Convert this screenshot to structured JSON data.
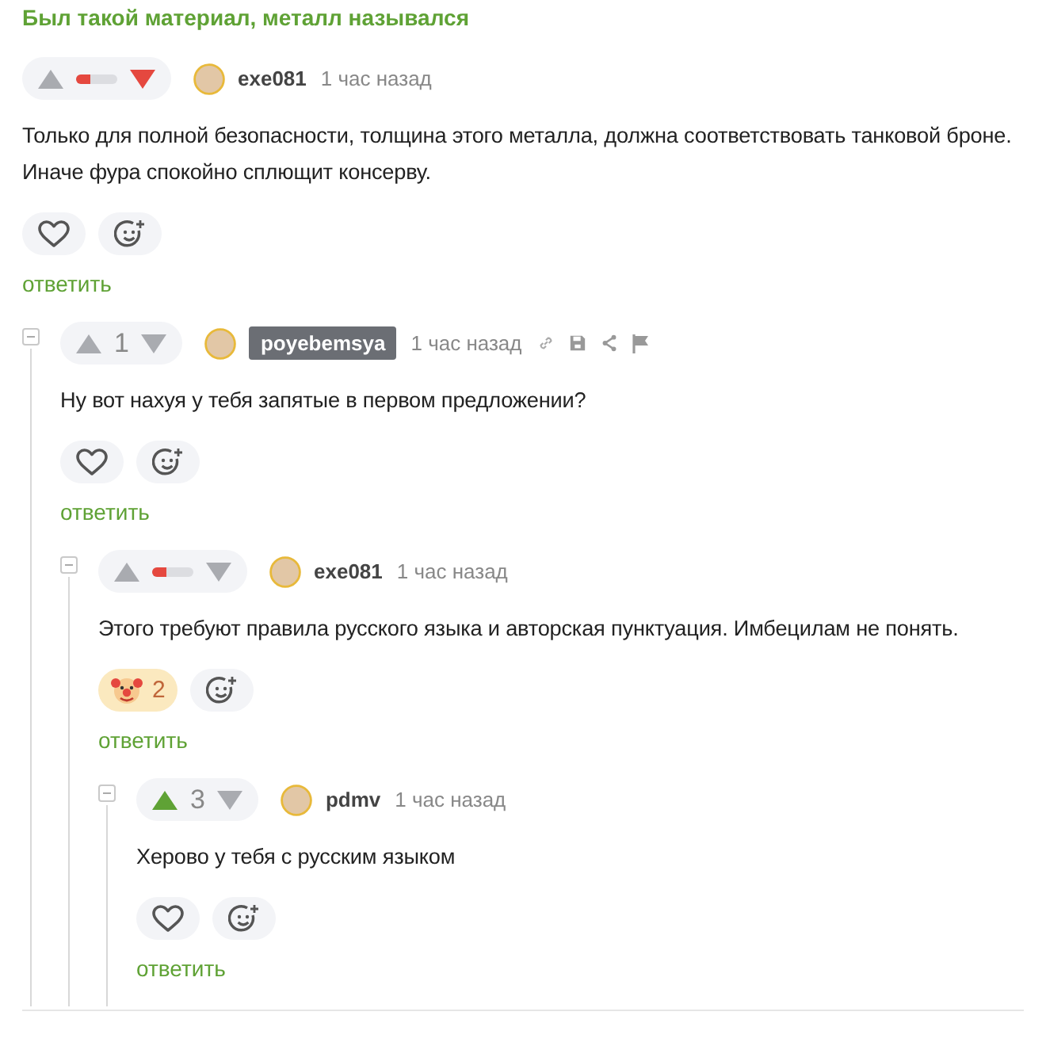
{
  "post_title": "Был такой материал, металл назывался",
  "comments": [
    {
      "rating": {
        "kind": "bar",
        "level": 0.35,
        "upvoted": false,
        "downvoted": true
      },
      "author": "exe081",
      "op": false,
      "time": "1 час назад",
      "actions_visible": false,
      "text": "Только для полной безопасности, толщина этого металла, должна соответствовать танковой броне. Иначе фура спокойно сплющит консерву.",
      "reaction": {
        "kind": "heart"
      },
      "reply": "ответить",
      "children": [
        {
          "rating": {
            "kind": "count",
            "count": "1",
            "upvoted": false,
            "downvoted": false
          },
          "author": "poyebemsya",
          "op": true,
          "time": "1 час назад",
          "actions_visible": true,
          "text": "Ну вот нахуя у тебя запятые в первом предложении?",
          "reaction": {
            "kind": "heart"
          },
          "reply": "ответить",
          "children": [
            {
              "rating": {
                "kind": "bar",
                "level": 0.35,
                "upvoted": false,
                "downvoted": false
              },
              "author": "exe081",
              "op": false,
              "time": "1 час назад",
              "actions_visible": false,
              "text": "Этого требуют правила русского языка и авторская пунктуация. Имбецилам не понять.",
              "reaction": {
                "kind": "clown",
                "count": "2",
                "selected": true
              },
              "reply": "ответить",
              "children": [
                {
                  "rating": {
                    "kind": "count",
                    "count": "3",
                    "upvoted": true,
                    "downvoted": false
                  },
                  "author": "pdmv",
                  "op": false,
                  "time": "1 час назад",
                  "actions_visible": false,
                  "text": "Херово у тебя с русским языком",
                  "reaction": {
                    "kind": "heart"
                  },
                  "reply": "ответить"
                }
              ]
            }
          ]
        }
      ]
    }
  ]
}
